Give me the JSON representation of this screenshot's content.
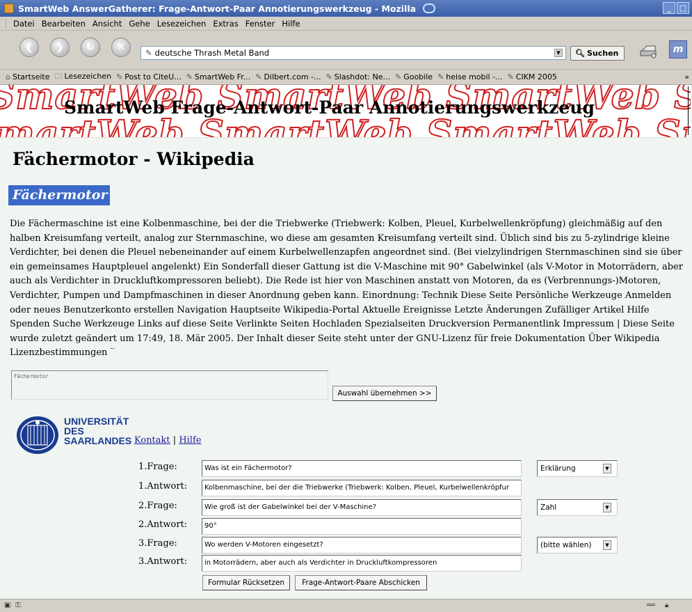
{
  "window": {
    "title": "SmartWeb AnswerGatherer: Frage-Antwort-Paar Annotierungswerkzeug - Mozilla",
    "controls": [
      "_",
      "□",
      "✕"
    ]
  },
  "menu": [
    {
      "label": "Datei"
    },
    {
      "label": "Bearbeiten"
    },
    {
      "label": "Ansicht"
    },
    {
      "label": "Gehe"
    },
    {
      "label": "Lesezeichen"
    },
    {
      "label": "Extras"
    },
    {
      "label": "Fenster"
    },
    {
      "label": "Hilfe"
    }
  ],
  "navigation": {
    "url": "deutsche Thrash Metal Band",
    "search_label": "Suchen",
    "icons": [
      "back-icon",
      "forward-icon",
      "reload-icon",
      "stop-icon",
      "print-icon",
      "throbber-icon"
    ]
  },
  "bookmarks": [
    {
      "label": "Startseite",
      "icon": "home-icon"
    },
    {
      "label": "Lesezeichen",
      "icon": "folder-icon"
    },
    {
      "label": "Post to CiteU...",
      "icon": "bookmark-icon"
    },
    {
      "label": "SmartWeb Fr...",
      "icon": "bookmark-icon"
    },
    {
      "label": "Dilbert.com -...",
      "icon": "bookmark-icon"
    },
    {
      "label": "Slashdot: Ne...",
      "icon": "bookmark-icon"
    },
    {
      "label": "Goobile",
      "icon": "bookmark-icon"
    },
    {
      "label": "heise mobil -...",
      "icon": "bookmark-icon"
    },
    {
      "label": "CIKM 2005",
      "icon": "bookmark-icon"
    }
  ],
  "banner": {
    "title": "SmartWeb Frage-Antwort-Paar Annotierungswerkzeug",
    "watermark": "SmartWeb"
  },
  "page": {
    "heading": "Fächermotor - Wikipedia",
    "article_label": "Fächermotor",
    "article_text": "Die Fächermaschine ist eine Kolbenmaschine, bei der die Triebwerke (Triebwerk: Kolben, Pleuel, Kurbelwellenkröpfung) gleichmäßig auf den halben Kreisumfang verteilt, analog zur Sternmaschine, wo diese am gesamten Kreisumfang verteilt sind. Üblich sind bis zu 5-zylindrige kleine Verdichter, bei denen die Pleuel nebeneinander auf einem Kurbelwellenzapfen angeordnet sind. (Bei vielzylindrigen Sternmaschinen sind sie über ein gemeinsames Hauptpleuel angelenkt) Ein Sonderfall dieser Gattung ist die V-Maschine mit 90° Gabelwinkel (als V-Motor in Motorrädern, aber auch als Verdichter in Druckluftkompressoren beliebt). Die Rede ist hier von Maschinen anstatt von Motoren, da es (Verbrennungs-)Motoren, Verdichter, Pumpen und Dampfmaschinen in dieser Anordnung geben kann. Einordnung: Technik Diese Seite Persönliche Werkzeuge Anmelden oder neues Benutzerkonto erstellen Navigation Hauptseite Wikipedia-Portal Aktuelle Ereignisse Letzte Änderungen Zufälliger Artikel Hilfe Spenden Suche Werkzeuge Links auf diese Seite Verlinkte Seiten Hochladen Spezialseiten Druckversion Permanentlink Impressum | Diese Seite wurde zuletzt geändert um 17:49, 18. Mär 2005. Der Inhalt dieser Seite steht unter der GNU-Lizenz für freie Dokumentation Über Wikipedia Lizenzbestimmungen ‾"
  },
  "selection": {
    "text": "Fächermotor",
    "take_button": "Auswahl übernehmen >>"
  },
  "university": {
    "name_line1": "UNIVERSITÄT",
    "name_line2": "DES",
    "name_line3": "SAARLANDES",
    "link_contact": "Kontakt",
    "separator": "|",
    "link_help": "Hilfe"
  },
  "qa_pairs": [
    {
      "q_label": "1.Frage:",
      "question": "Was ist ein Fächermotor?",
      "type": "Erklärung",
      "a_label": "1.Antwort:",
      "answer": "Kolbenmaschine, bei der die Triebwerke (Triebwerk: Kolben, Pleuel, Kurbelwellenkröpfur"
    },
    {
      "q_label": "2.Frage:",
      "question": "Wie groß ist der Gabelwinkel bei der V-Maschine?",
      "type": "Zahl",
      "a_label": "2.Antwort:",
      "answer": "90°"
    },
    {
      "q_label": "3.Frage:",
      "question": "Wo werden V-Motoren eingesetzt?",
      "type": "(bitte wählen)",
      "a_label": "3.Antwort:",
      "answer": "in Motorrädern, aber auch als Verdichter in Druckluftkompressoren"
    }
  ],
  "form_buttons": {
    "reset": "Formular Rücksetzen",
    "submit": "Frage-Antwort-Paare Abschicken"
  },
  "colors": {
    "titlebar": "#3a5ea8",
    "banner_watermark": "#d02020",
    "selection_highlight": "#3b69c9",
    "university_blue": "#1a3a8f",
    "content_bg": "#f0f5f2"
  }
}
